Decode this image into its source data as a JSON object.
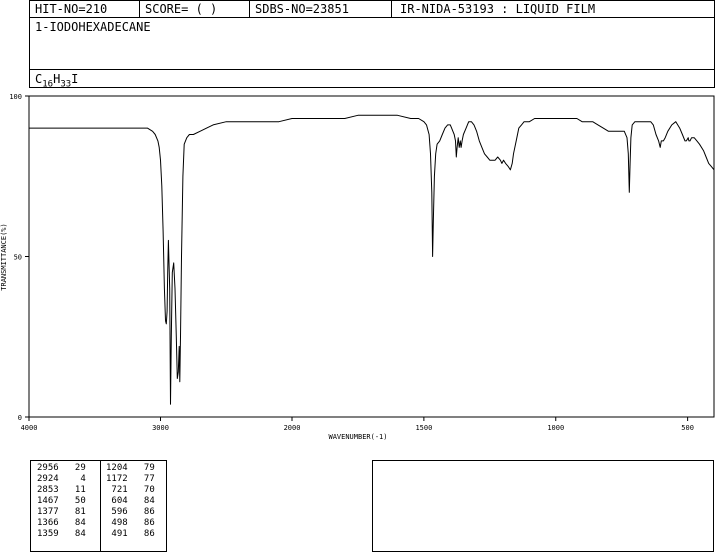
{
  "header": {
    "hit_no": "HIT-NO=210",
    "score": "SCORE=  (   )",
    "sdbs_no": "SDBS-NO=23851",
    "ir_info": "IR-NIDA-53193 : LIQUID FILM"
  },
  "compound": {
    "name": "1-IODOHEXADECANE",
    "formula_parts": [
      "C",
      "16",
      "H",
      "33",
      "I"
    ]
  },
  "chart_data": {
    "type": "line",
    "xlabel": "WAVENUMBER(-1)",
    "ylabel": "TRANSMITTANCE(%)",
    "xlim": [
      4000,
      400
    ],
    "ylim": [
      0,
      100
    ],
    "x_ticks": [
      4000,
      3000,
      2000,
      1500,
      1000,
      500
    ],
    "y_ticks": [
      0,
      50,
      100
    ],
    "grid": false,
    "series": [
      {
        "x": [
          4000,
          3900,
          3800,
          3700,
          3600,
          3500,
          3400,
          3300,
          3200,
          3100,
          3060,
          3040,
          3020,
          3010,
          3000,
          2990,
          2980,
          2970,
          2962,
          2956,
          2950,
          2945,
          2940,
          2930,
          2924,
          2918,
          2910,
          2900,
          2890,
          2880,
          2872,
          2865,
          2858,
          2853,
          2848,
          2840,
          2830,
          2820,
          2800,
          2780,
          2750,
          2700,
          2600,
          2500,
          2400,
          2300,
          2200,
          2100,
          2000,
          1900,
          1800,
          1750,
          1700,
          1650,
          1600,
          1550,
          1520,
          1500,
          1490,
          1480,
          1475,
          1470,
          1467,
          1464,
          1460,
          1455,
          1450,
          1440,
          1430,
          1420,
          1410,
          1400,
          1395,
          1390,
          1385,
          1380,
          1377,
          1374,
          1370,
          1366,
          1362,
          1359,
          1355,
          1350,
          1340,
          1330,
          1320,
          1310,
          1300,
          1290,
          1280,
          1270,
          1260,
          1250,
          1240,
          1230,
          1220,
          1210,
          1204,
          1198,
          1190,
          1180,
          1172,
          1165,
          1160,
          1150,
          1140,
          1130,
          1120,
          1110,
          1100,
          1080,
          1050,
          1020,
          1000,
          980,
          960,
          940,
          920,
          900,
          880,
          860,
          840,
          820,
          800,
          780,
          760,
          740,
          730,
          725,
          721,
          718,
          715,
          710,
          700,
          690,
          680,
          660,
          640,
          630,
          620,
          610,
          604,
          600,
          596,
          592,
          585,
          575,
          560,
          545,
          530,
          520,
          510,
          505,
          498,
          495,
          491,
          485,
          475,
          465,
          455,
          440,
          430,
          420,
          410,
          400
        ],
        "y": [
          90,
          90,
          90,
          90,
          90,
          90,
          90,
          90,
          90,
          90,
          89,
          88,
          86,
          84,
          80,
          72,
          58,
          40,
          30,
          29,
          33,
          45,
          55,
          40,
          4,
          25,
          45,
          48,
          40,
          25,
          12,
          14,
          22,
          11,
          25,
          50,
          75,
          85,
          87,
          88,
          88,
          89,
          91,
          92,
          92,
          92,
          92,
          92,
          93,
          93,
          93,
          94,
          94,
          94,
          94,
          93,
          93,
          92,
          91,
          88,
          82,
          70,
          50,
          62,
          75,
          82,
          85,
          86,
          88,
          90,
          91,
          91,
          90,
          89,
          88,
          86,
          81,
          84,
          87,
          84,
          86,
          84,
          86,
          88,
          90,
          92,
          92,
          91,
          89,
          86,
          84,
          82,
          81,
          80,
          80,
          80,
          81,
          80,
          79,
          80,
          79,
          78,
          77,
          79,
          82,
          86,
          90,
          91,
          92,
          92,
          92,
          93,
          93,
          93,
          93,
          93,
          93,
          93,
          93,
          92,
          92,
          92,
          91,
          90,
          89,
          89,
          89,
          89,
          87,
          82,
          70,
          79,
          87,
          91,
          92,
          92,
          92,
          92,
          92,
          91,
          88,
          86,
          84,
          86,
          86,
          86,
          87,
          89,
          91,
          92,
          90,
          88,
          86,
          86,
          87,
          86,
          86,
          87,
          87,
          86,
          85,
          83,
          81,
          79,
          78,
          77
        ]
      }
    ]
  },
  "peak_table": {
    "left": [
      [
        "2956",
        "29"
      ],
      [
        "2924",
        "4"
      ],
      [
        "2853",
        "11"
      ],
      [
        "1467",
        "50"
      ],
      [
        "1377",
        "81"
      ],
      [
        "1366",
        "84"
      ],
      [
        "1359",
        "84"
      ]
    ],
    "right": [
      [
        "1204",
        "79"
      ],
      [
        "1172",
        "77"
      ],
      [
        "721",
        "70"
      ],
      [
        "604",
        "84"
      ],
      [
        "596",
        "86"
      ],
      [
        "498",
        "86"
      ],
      [
        "491",
        "86"
      ]
    ]
  }
}
